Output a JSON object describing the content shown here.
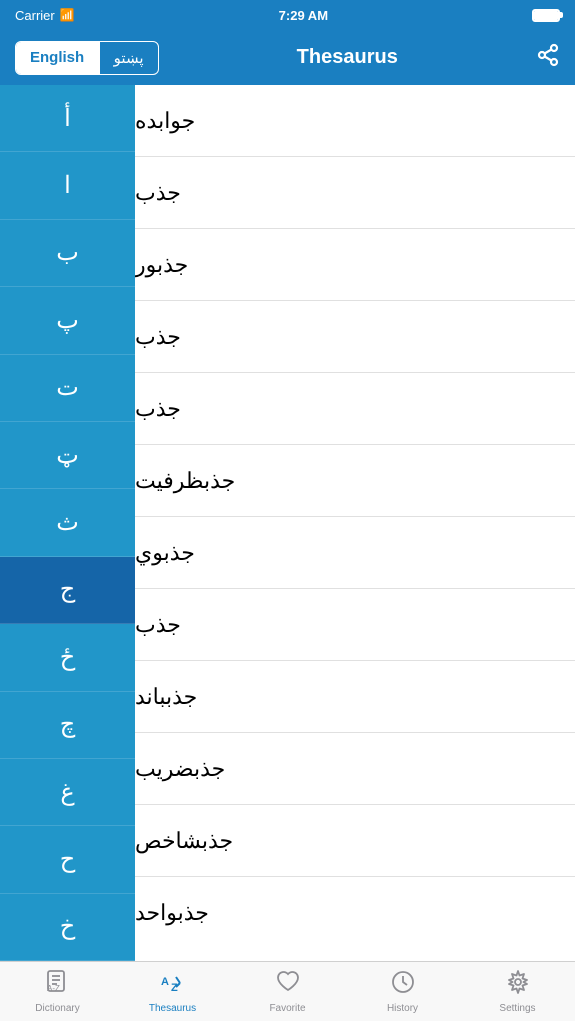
{
  "statusBar": {
    "carrier": "Carrier",
    "time": "7:29 AM"
  },
  "header": {
    "langEnglish": "English",
    "langPashto": "پښتو",
    "title": "Thesaurus",
    "shareLabel": "share"
  },
  "alphabet": [
    {
      "letter": "أ",
      "selected": false
    },
    {
      "letter": "ا",
      "selected": false
    },
    {
      "letter": "ب",
      "selected": false
    },
    {
      "letter": "پ",
      "selected": false
    },
    {
      "letter": "ت",
      "selected": false
    },
    {
      "letter": "ټ",
      "selected": false
    },
    {
      "letter": "ث",
      "selected": false
    },
    {
      "letter": "ج",
      "selected": true
    },
    {
      "letter": "ځ",
      "selected": false
    },
    {
      "letter": "چ",
      "selected": false
    },
    {
      "letter": "غ",
      "selected": false
    },
    {
      "letter": "ح",
      "selected": false
    },
    {
      "letter": "خ",
      "selected": false
    }
  ],
  "words": [
    "جوابده",
    "جذب",
    "جذبور",
    "جذب",
    "جذب",
    "جذبظرفيت",
    "جذبوي",
    "جذب",
    "جذبباند",
    "جذبضريب",
    "جذبشاخص",
    "جذبواحد"
  ],
  "tabs": [
    {
      "id": "dictionary",
      "label": "Dictionary",
      "active": false
    },
    {
      "id": "thesaurus",
      "label": "Thesaurus",
      "active": true
    },
    {
      "id": "favorite",
      "label": "Favorite",
      "active": false
    },
    {
      "id": "history",
      "label": "History",
      "active": false
    },
    {
      "id": "settings",
      "label": "Settings",
      "active": false
    }
  ]
}
